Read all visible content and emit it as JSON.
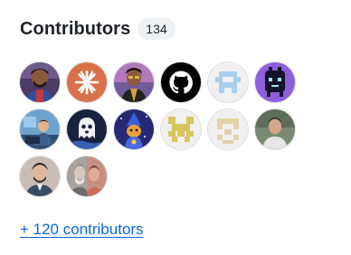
{
  "contributors": {
    "title": "Contributors",
    "count": "134",
    "more_link": "+ 120 contributors",
    "link_color": "#0969da",
    "avatars": [
      {
        "icon": "illustrated-man-avatar",
        "color": "#5a4a72"
      },
      {
        "icon": "orange-asterisk-avatar",
        "color": "#d9704a"
      },
      {
        "icon": "illustrated-man-avatar",
        "color": "#a86fb3"
      },
      {
        "icon": "github-octocat-avatar",
        "color": "#000000"
      },
      {
        "icon": "blue-pixel-identicon-avatar",
        "color": "#a9cfee"
      },
      {
        "icon": "pixel-monster-avatar",
        "color": "#6a3fb8"
      },
      {
        "icon": "illustrated-person-avatar",
        "color": "#4e86b8"
      },
      {
        "icon": "ghost-avatar",
        "color": "#1c2a4a"
      },
      {
        "icon": "wizard-cat-avatar",
        "color": "#2d2f7a"
      },
      {
        "icon": "yellow-pixel-identicon-avatar",
        "color": "#d9c65a"
      },
      {
        "icon": "beige-pixel-identicon-avatar",
        "color": "#e6d6b0"
      },
      {
        "icon": "photo-person-avatar",
        "color": "#6b7b6a"
      },
      {
        "icon": "photo-person-avatar",
        "color": "#b8a8a0"
      },
      {
        "icon": "photo-person-avatar",
        "color": "#c78f80"
      }
    ]
  }
}
